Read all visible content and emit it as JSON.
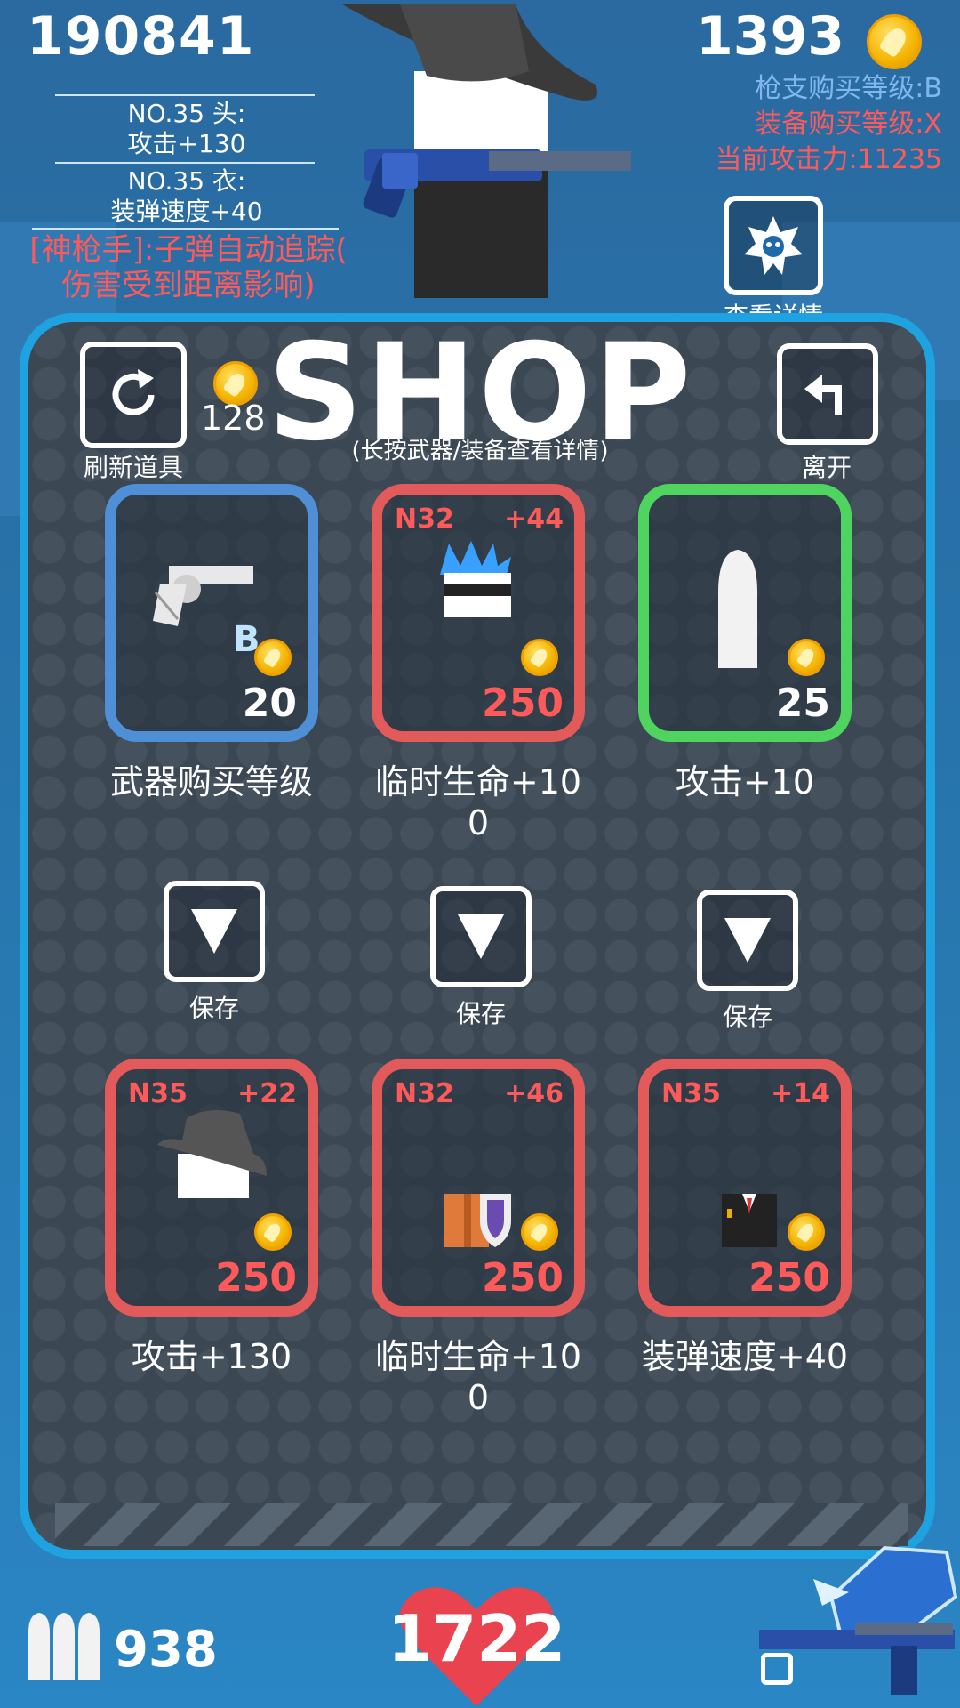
{
  "hud": {
    "score": "190841",
    "money": "1393",
    "equip_head_title": "NO.35 头:",
    "equip_head_stat": "攻击+130",
    "equip_body_title": "NO.35 衣:",
    "equip_body_stat": "装弹速度+40",
    "perk_line1": "[神枪手]:子弹自动追踪(",
    "perk_line2": "伤害受到距离影响)",
    "gun_level": "枪支购买等级:B",
    "equip_level": "装备购买等级:X",
    "attack_power": "当前攻击力:11235",
    "details_label": "查看详情"
  },
  "shop": {
    "title": "SHOP",
    "subtitle": "(长按武器/装备查看详情)",
    "refresh_cost": "128",
    "refresh_label": "刷新道具",
    "exit_label": "离开",
    "save_label": "保存",
    "top_items": [
      {
        "code": "",
        "bonus": "",
        "badge": "B",
        "price": "20",
        "label": "武器购买等级",
        "border": "#4f8fd6",
        "icon": "revolver-icon"
      },
      {
        "code": "N32",
        "bonus": "+44",
        "price": "250",
        "label": "临时生命+10\n0",
        "border": "#e25a5a",
        "icon": "spiky-mask-head-icon"
      },
      {
        "code": "",
        "bonus": "",
        "price": "25",
        "label": "攻击+10",
        "border": "#4fd45f",
        "icon": "bullet-icon"
      }
    ],
    "bottom_items": [
      {
        "code": "N35",
        "bonus": "+22",
        "price": "250",
        "label": "攻击+130",
        "border": "#e25a5a",
        "icon": "fedora-hat-icon"
      },
      {
        "code": "N32",
        "bonus": "+46",
        "price": "250",
        "label": "临时生命+10\n0",
        "border": "#e25a5a",
        "icon": "shield-armor-icon"
      },
      {
        "code": "N35",
        "bonus": "+14",
        "price": "250",
        "label": "装弹速度+40",
        "border": "#e25a5a",
        "icon": "suit-icon"
      }
    ]
  },
  "footer": {
    "ammo": "938",
    "health": "1722"
  }
}
